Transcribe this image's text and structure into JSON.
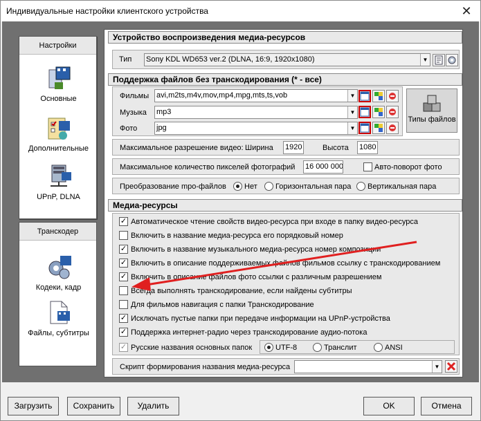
{
  "window": {
    "title": "Индивидуальные настройки клиентского устройства",
    "close": "✕"
  },
  "sidebar": {
    "group1": "Настройки",
    "items1": [
      "Основные",
      "Дополнительные",
      "UPnP, DLNA"
    ],
    "group2": "Транскодер",
    "items2": [
      "Кодеки, кадр",
      "Файлы, субтитры"
    ]
  },
  "device": {
    "header": "Устройство воспроизведения медиа-ресурсов",
    "type_label": "Тип",
    "type_value": "Sony KDL WD653 ver.2 (DLNA, 16:9, 1920x1080)"
  },
  "support": {
    "header": "Поддержка файлов без транскодирования (* - все)",
    "films_label": "Фильмы",
    "films_value": "avi,m2ts,m4v,mov,mp4,mpg,mts,ts,vob",
    "music_label": "Музыка",
    "music_value": "mp3",
    "photo_label": "Фото",
    "photo_value": "jpg",
    "file_types": "Типы файлов",
    "maxres_label": "Максимальное разрешение видео:",
    "width_label": "Ширина",
    "width_value": "1920",
    "height_label": "Высота",
    "height_value": "1080",
    "maxpix_label": "Максимальное количество пикселей фотографий",
    "maxpix_value": "16 000 000",
    "autorotate": "Авто-поворот фото",
    "mpo_label": "Преобразование mpo-файлов",
    "mpo_no": "Нет",
    "mpo_h": "Горизонтальная пара",
    "mpo_v": "Вертикальная пара"
  },
  "media": {
    "header": "Медиа-ресурсы",
    "options": [
      {
        "label": "Автоматическое чтение свойств видео-ресурса при входе в папку видео-ресурса",
        "checked": true
      },
      {
        "label": "Включить в название медиа-ресурса его порядковый номер",
        "checked": false
      },
      {
        "label": "Включить в название музыкального медиа-ресурса номер композиции",
        "checked": true
      },
      {
        "label": "Включить в описание поддерживаемых файлов фильмов ссылку с транскодированием",
        "checked": true
      },
      {
        "label": "Включить в описание файлов фото ссылки с различным разрешением",
        "checked": true
      },
      {
        "label": "Всегда выполнять транскодирование, если найдены субтитры",
        "checked": false
      },
      {
        "label": "Для фильмов навигация с папки Транскодирование",
        "checked": false
      },
      {
        "label": "Исключать пустые папки при передаче информации на  UPnP-устройства",
        "checked": true
      },
      {
        "label": "Поддержка интернет-радио через транскодирование аудио-потока",
        "checked": true
      }
    ],
    "russian_label": "Русские названия основных папок",
    "enc_utf8": "UTF-8",
    "enc_translit": "Транслит",
    "enc_ansi": "ANSI",
    "script_label": "Скрипт формирования названия медиа-ресурса"
  },
  "buttons": {
    "load": "Загрузить",
    "save": "Сохранить",
    "delete": "Удалить",
    "ok": "OK",
    "cancel": "Отмена"
  },
  "colors": {
    "accent": "#cc0000",
    "arrow": "#e02020"
  }
}
